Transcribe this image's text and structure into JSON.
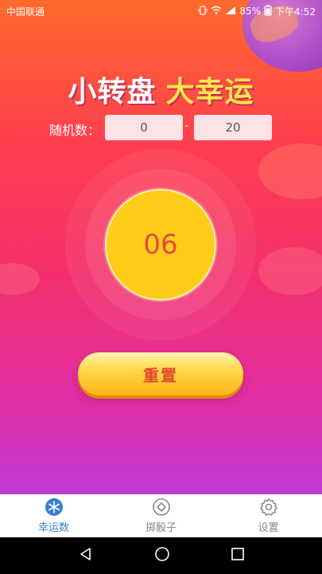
{
  "status_bar": {
    "carrier": "中国联通",
    "battery": "85%",
    "time": "下午4:52"
  },
  "title": {
    "part1": "小转盘",
    "part2": "大幸运"
  },
  "range": {
    "label": "随机数：",
    "min": "0",
    "separator": "-",
    "max": "20"
  },
  "wheel": {
    "value": "06"
  },
  "reset_button": {
    "label": "重置"
  },
  "tabs": [
    {
      "label": "幸运数",
      "icon": "snowflake-icon",
      "active": true
    },
    {
      "label": "掷骰子",
      "icon": "dice-icon",
      "active": false
    },
    {
      "label": "设置",
      "icon": "gear-icon",
      "active": false
    }
  ],
  "colors": {
    "accent": "#3a7fd0",
    "wheel": "#ffcc1a",
    "wheel_text": "#e24a3c",
    "title_highlight": "#ffe74a"
  }
}
